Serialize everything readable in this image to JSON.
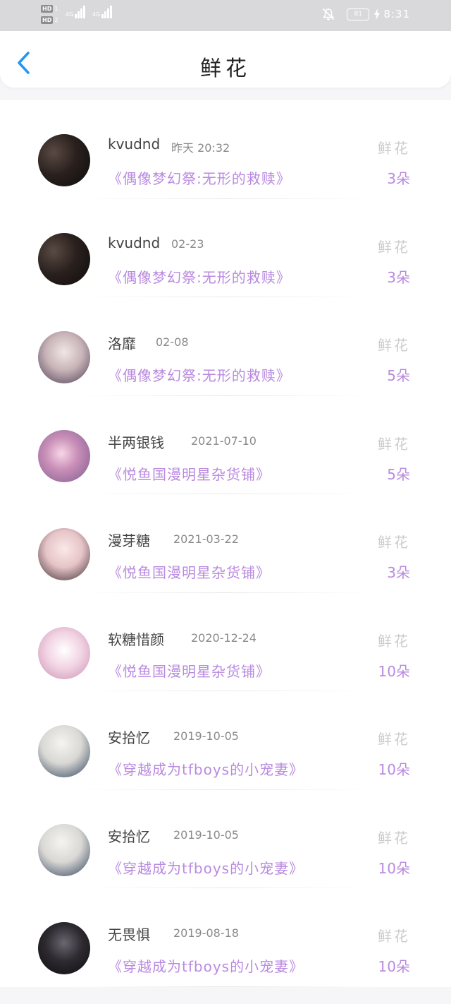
{
  "status_bar": {
    "hd1_label": "HD",
    "hd1_num": "1",
    "hd2_label": "HD",
    "hd2_num": "2",
    "signal1_label": "4G",
    "signal2_label": "4G",
    "battery_level": "81",
    "time": "8:31"
  },
  "header": {
    "title": "鲜花",
    "back_icon": "chevron-left-icon"
  },
  "colors": {
    "accent": "#b98ae0",
    "back_arrow": "#2196f3"
  },
  "records": [
    {
      "name": "kvudnd",
      "date": "昨天 20:32",
      "label": "鲜花",
      "work": "《偶像梦幻祭:无形的救赎》",
      "count": "3朵",
      "avatar": "dark-figure-avatar"
    },
    {
      "name": "kvudnd",
      "date": "02-23",
      "label": "鲜花",
      "work": "《偶像梦幻祭:无形的救赎》",
      "count": "3朵",
      "avatar": "dark-figure-avatar"
    },
    {
      "name": "洛靡",
      "date": "02-08",
      "label": "鲜花",
      "work": "《偶像梦幻祭:无形的救赎》",
      "count": "5朵",
      "avatar": "anime-boy-avatar"
    },
    {
      "name": "半两银钱",
      "date": "2021-07-10",
      "label": "鲜花",
      "work": "《悦鱼国漫明星杂货铺》",
      "count": "5朵",
      "avatar": "anime-girl-avatar"
    },
    {
      "name": "漫芽糖",
      "date": "2021-03-22",
      "label": "鲜花",
      "work": "《悦鱼国漫明星杂货铺》",
      "count": "3朵",
      "avatar": "illustrated-girl-avatar"
    },
    {
      "name": "软糖惜颜",
      "date": "2020-12-24",
      "label": "鲜花",
      "work": "《悦鱼国漫明星杂货铺》",
      "count": "10朵",
      "avatar": "bunny-girl-avatar"
    },
    {
      "name": "安拾忆",
      "date": "2019-10-05",
      "label": "鲜花",
      "work": "《穿越成为tfboys的小宠妻》",
      "count": "10朵",
      "avatar": "white-dog-avatar"
    },
    {
      "name": "安拾忆",
      "date": "2019-10-05",
      "label": "鲜花",
      "work": "《穿越成为tfboys的小宠妻》",
      "count": "10朵",
      "avatar": "white-dog-avatar"
    },
    {
      "name": "无畏惧",
      "date": "2019-08-18",
      "label": "鲜花",
      "work": "《穿越成为tfboys的小宠妻》",
      "count": "10朵",
      "avatar": "dark-portrait-avatar"
    }
  ]
}
